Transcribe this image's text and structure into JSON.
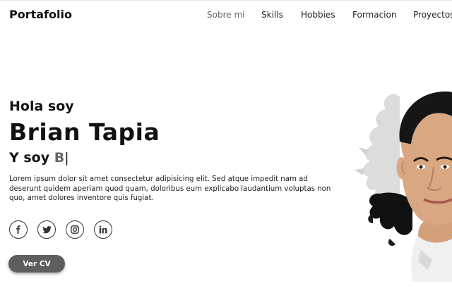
{
  "header": {
    "logo": "Portafolio",
    "nav": [
      {
        "label": "Sobre mi",
        "active": true
      },
      {
        "label": "Skills",
        "active": false
      },
      {
        "label": "Hobbies",
        "active": false
      },
      {
        "label": "Formacion",
        "active": false
      },
      {
        "label": "Proyectos",
        "active": false
      }
    ]
  },
  "hero": {
    "greeting": "Hola soy",
    "name": "Brian Tapia",
    "role_prefix": "Y soy",
    "role_typed": "B",
    "cursor": "|",
    "description": "Lorem ipsum dolor sit amet consectetur adipisicing elit. Sed atque impedit nam ad deserunt quidem aperiam quod quam, doloribus eum explicabo laudantium voluptas non quo, amet dolores inventore quis fugiat."
  },
  "socials": [
    {
      "icon": "facebook-icon"
    },
    {
      "icon": "twitter-icon"
    },
    {
      "icon": "instagram-icon"
    },
    {
      "icon": "linkedin-icon"
    }
  ],
  "cta": {
    "label": "Ver CV"
  },
  "colors": {
    "accent": "#5e5e5e",
    "text": "#111111",
    "typed": "#666666"
  }
}
